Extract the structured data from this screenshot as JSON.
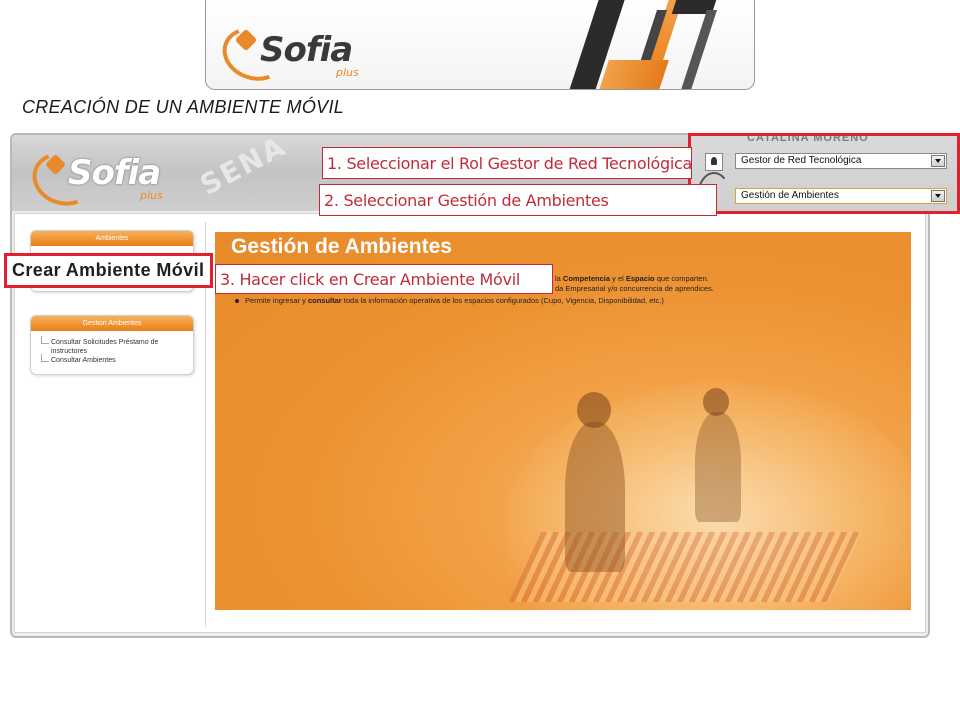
{
  "logo": {
    "word": "Sofia",
    "plus": "plus"
  },
  "slide": {
    "title": "CREACIÓN DE UN AMBIENTE MÓVIL"
  },
  "app": {
    "watermark": "SENA",
    "user_name": "CATALINA MORENO",
    "role_select": "Gestor de Red Tecnológica",
    "module_select": "Gestión de Ambientes"
  },
  "sidebar": {
    "ambientes_title": "Ambientes",
    "crear_link": "Crear Ambiente Móvil",
    "gestion_title": "Gestion Ambientes",
    "gestion_items": [
      "Consultar Solicitudes Préstamo de",
      "instructores",
      "Consultar Ambientes"
    ]
  },
  "main": {
    "title": "Gestión de Ambientes",
    "line1_prefix": "la ",
    "line1_competencia": "Competencia",
    "line1_mid": " y el ",
    "line1_espacio": "Espacio",
    "line1_suffix": " que comparten.",
    "line2": "da Empresarial y/o concurrencia de aprendices.",
    "bullet_prefix": "Permite ingresar y ",
    "bullet_bold": "consultar",
    "bullet_suffix": " toda la información operativa de los espacios configurados (Cupo, Vigencia, Disponibilidad, etc.)"
  },
  "annotations": {
    "step1": "1. Seleccionar el Rol Gestor de Red Tecnológica",
    "step2": "2. Seleccionar Gestión de Ambientes",
    "step3": "3. Hacer click en Crear Ambiente Móvil"
  },
  "colors": {
    "accent": "#e98a2a",
    "callout": "#c12b38",
    "highlight": "#e0202e"
  }
}
